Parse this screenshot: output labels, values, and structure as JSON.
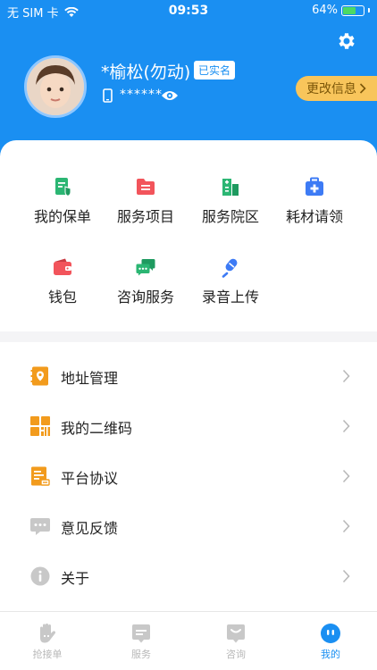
{
  "status_bar": {
    "carrier": "无 SIM 卡",
    "time": "09:53",
    "battery": "64%",
    "battery_level": 0.64
  },
  "profile": {
    "name": "*榆松(勿动)",
    "verified_label": "已实名",
    "phone_masked": "******",
    "edit_label": "更改信息"
  },
  "grid": [
    {
      "label": "我的保单",
      "icon": "policy-icon",
      "color": "#2bb673"
    },
    {
      "label": "服务项目",
      "icon": "folder-icon",
      "color": "#f2545b"
    },
    {
      "label": "服务院区",
      "icon": "building-icon",
      "color": "#2bb673"
    },
    {
      "label": "耗材请领",
      "icon": "medkit-icon",
      "color": "#3d7bf5"
    },
    {
      "label": "钱包",
      "icon": "wallet-icon",
      "color": "#f2545b"
    },
    {
      "label": "咨询服务",
      "icon": "chat-icon",
      "color": "#2bb673"
    },
    {
      "label": "录音上传",
      "icon": "mic-icon",
      "color": "#3d7bf5"
    }
  ],
  "menu": [
    {
      "label": "地址管理",
      "icon": "address-book-icon"
    },
    {
      "label": "我的二维码",
      "icon": "qrcode-icon"
    },
    {
      "label": "平台协议",
      "icon": "agreement-icon"
    },
    {
      "label": "意见反馈",
      "icon": "feedback-icon"
    },
    {
      "label": "关于",
      "icon": "info-icon"
    }
  ],
  "tabs": [
    {
      "label": "抢接单",
      "icon": "grab-order-icon"
    },
    {
      "label": "服务",
      "icon": "service-icon"
    },
    {
      "label": "咨询",
      "icon": "consult-icon"
    },
    {
      "label": "我的",
      "icon": "profile-icon",
      "active": true
    }
  ],
  "colors": {
    "primary": "#1a8ff2",
    "accent_orange": "#f29b1d",
    "edit_button": "#f8c55b"
  }
}
